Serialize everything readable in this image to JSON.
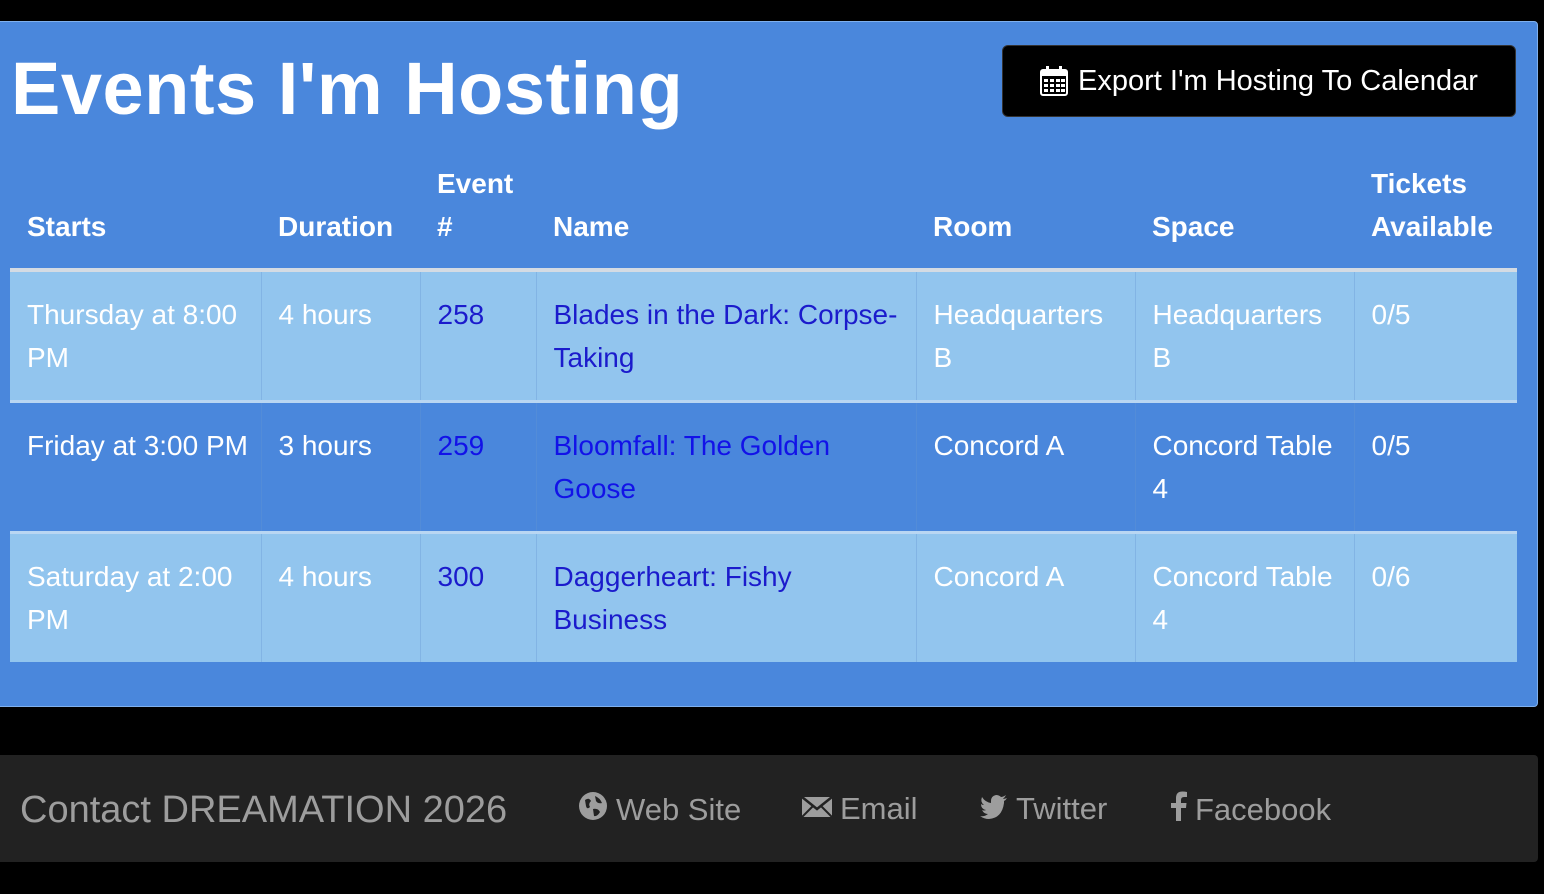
{
  "header": {
    "title": "Events I'm Hosting",
    "export_label": "Export I'm Hosting To Calendar",
    "export_icon": "calendar-icon"
  },
  "table": {
    "columns": [
      "Starts",
      "Duration",
      "Event #",
      "Name",
      "Room",
      "Space",
      "Tickets Available"
    ],
    "rows": [
      {
        "starts": "Thursday at 8:00 PM",
        "duration": "4 hours",
        "event_num": "258",
        "name": "Blades in the Dark: Corpse-Taking",
        "room": "Headquarters B",
        "space": "Headquarters B",
        "tickets": "0/5"
      },
      {
        "starts": "Friday at 3:00 PM",
        "duration": "3 hours",
        "event_num": "259",
        "name": "Bloomfall: The Golden Goose",
        "room": "Concord A",
        "space": "Concord Table 4",
        "tickets": "0/5"
      },
      {
        "starts": "Saturday at 2:00 PM",
        "duration": "4 hours",
        "event_num": "300",
        "name": "Daggerheart: Fishy Business",
        "room": "Concord A",
        "space": "Concord Table 4",
        "tickets": "0/6"
      }
    ]
  },
  "footer": {
    "brand": "Contact DREAMATION 2026",
    "links": [
      {
        "label": "Web Site",
        "icon": "globe-icon"
      },
      {
        "label": "Email",
        "icon": "envelope-icon"
      },
      {
        "label": "Twitter",
        "icon": "twitter-icon"
      },
      {
        "label": "Facebook",
        "icon": "facebook-icon"
      }
    ]
  },
  "colors": {
    "panel": "#4a87dc",
    "row_light": "#92c5ee",
    "link": "#1b1bcc",
    "footer": "#222222"
  }
}
